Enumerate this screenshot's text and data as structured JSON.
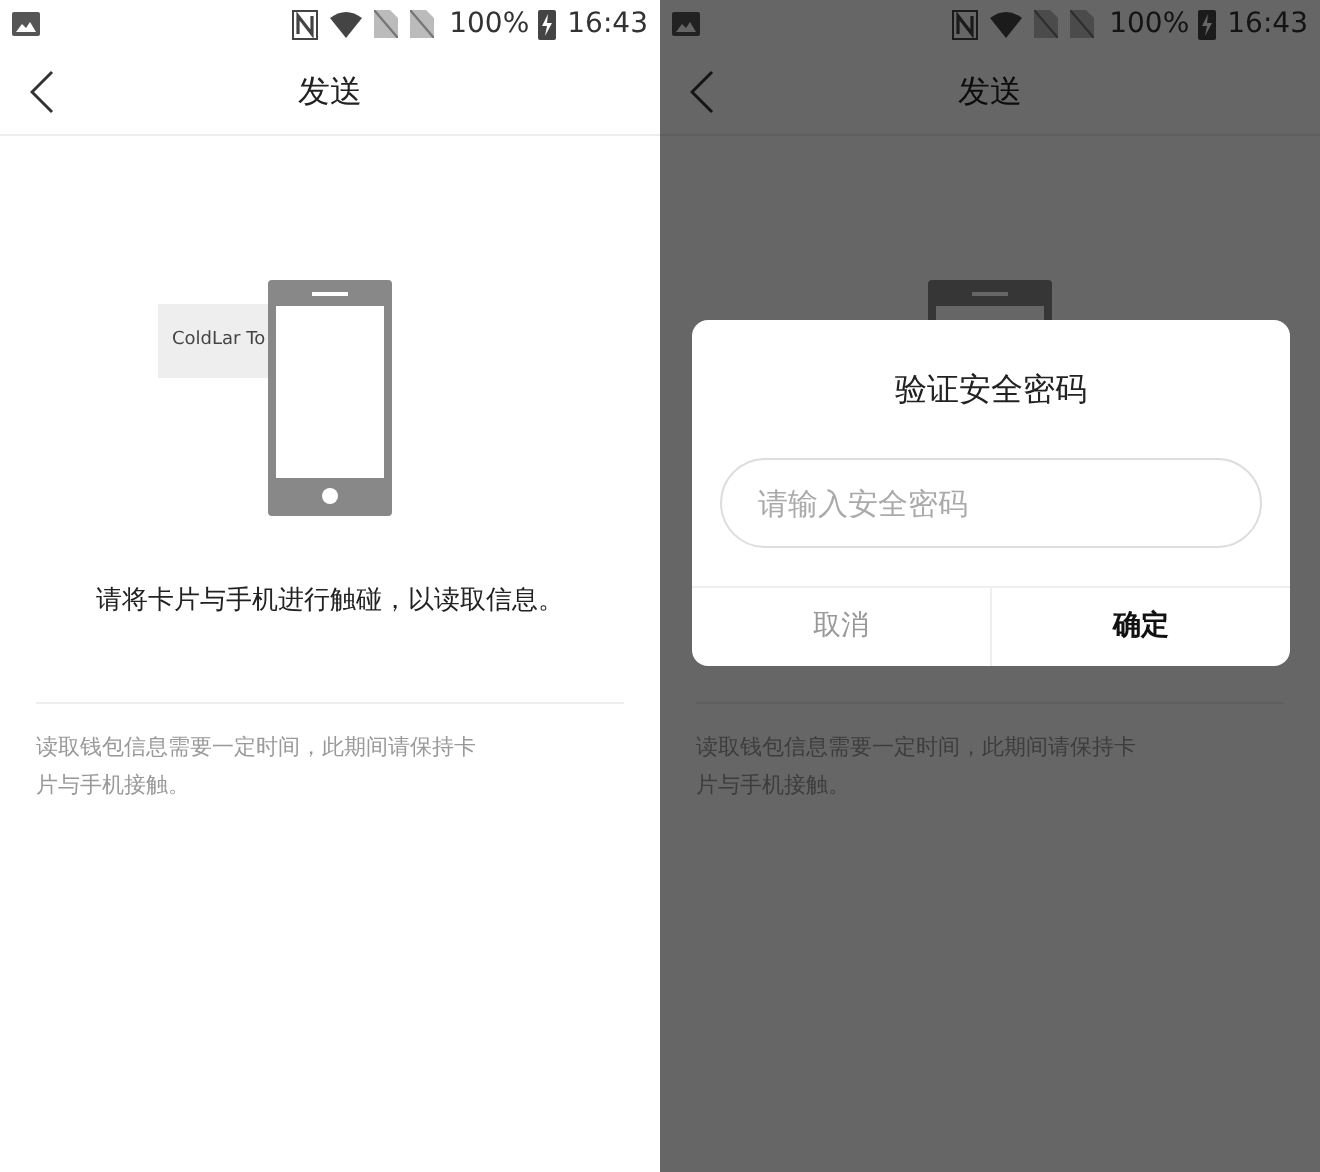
{
  "screens": [
    {
      "status_bar": {
        "battery": "100%",
        "time": "16:43"
      },
      "header": {
        "title": "发送"
      },
      "card_label": "ColdLar To",
      "instruction": "请将卡片与手机进行触碰，以读取信息。",
      "note": "读取钱包信息需要一定时间，此期间请保持卡片与手机接触。"
    },
    {
      "status_bar": {
        "battery": "100%",
        "time": "16:43"
      },
      "header": {
        "title": "发送"
      },
      "note": "读取钱包信息需要一定时间，此期间请保持卡片与手机接触。",
      "dialog": {
        "title": "验证安全密码",
        "placeholder": "请输入安全密码",
        "cancel": "取消",
        "confirm": "确定"
      }
    }
  ]
}
